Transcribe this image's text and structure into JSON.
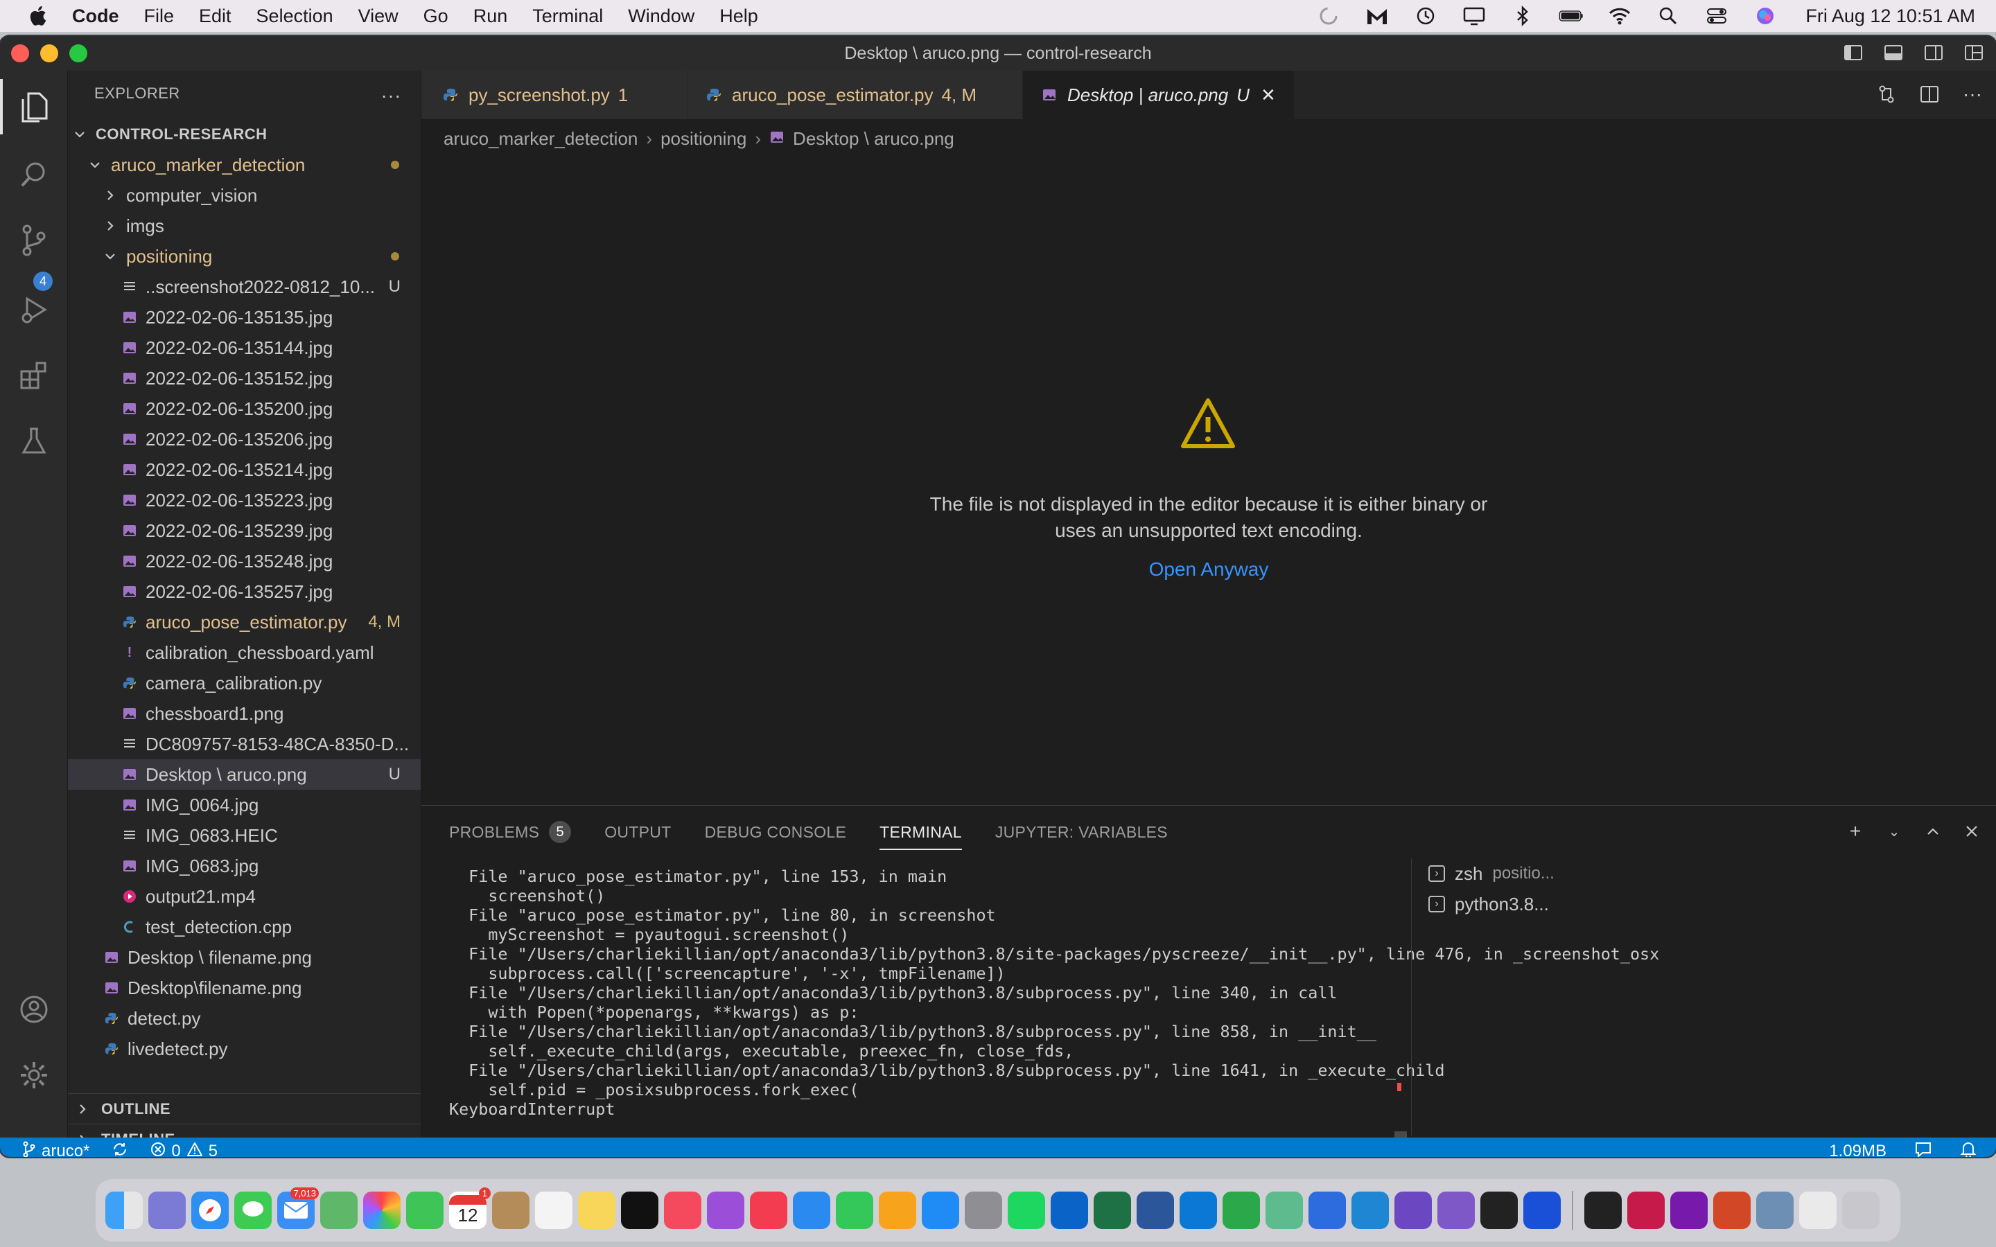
{
  "menubar": {
    "items": [
      "Code",
      "File",
      "Edit",
      "Selection",
      "View",
      "Go",
      "Run",
      "Terminal",
      "Window",
      "Help"
    ],
    "clock": "Fri Aug 12  10:51 AM"
  },
  "window": {
    "title": "Desktop \\ aruco.png — control-research"
  },
  "activity": {
    "scm_badge": "4"
  },
  "sidebar": {
    "header": "EXPLORER",
    "more": "···",
    "root": "CONTROL-RESEARCH",
    "tree": [
      {
        "label": "aruco_marker_detection",
        "indent": 0,
        "kind": "folder-open",
        "color": "yellow",
        "dot": true
      },
      {
        "label": "computer_vision",
        "indent": 1,
        "kind": "folder-closed"
      },
      {
        "label": "imgs",
        "indent": 1,
        "kind": "folder-closed"
      },
      {
        "label": "positioning",
        "indent": 1,
        "kind": "folder-open",
        "color": "yellow",
        "dot": true
      },
      {
        "label": "..screenshot2022-0812_10...",
        "indent": 2,
        "kind": "lines",
        "status": "U"
      },
      {
        "label": "2022-02-06-135135.jpg",
        "indent": 2,
        "kind": "image"
      },
      {
        "label": "2022-02-06-135144.jpg",
        "indent": 2,
        "kind": "image"
      },
      {
        "label": "2022-02-06-135152.jpg",
        "indent": 2,
        "kind": "image"
      },
      {
        "label": "2022-02-06-135200.jpg",
        "indent": 2,
        "kind": "image"
      },
      {
        "label": "2022-02-06-135206.jpg",
        "indent": 2,
        "kind": "image"
      },
      {
        "label": "2022-02-06-135214.jpg",
        "indent": 2,
        "kind": "image"
      },
      {
        "label": "2022-02-06-135223.jpg",
        "indent": 2,
        "kind": "image"
      },
      {
        "label": "2022-02-06-135239.jpg",
        "indent": 2,
        "kind": "image"
      },
      {
        "label": "2022-02-06-135248.jpg",
        "indent": 2,
        "kind": "image"
      },
      {
        "label": "2022-02-06-135257.jpg",
        "indent": 2,
        "kind": "image"
      },
      {
        "label": "aruco_pose_estimator.py",
        "indent": 2,
        "kind": "python",
        "color": "yellow",
        "status": "4, M"
      },
      {
        "label": "calibration_chessboard.yaml",
        "indent": 2,
        "kind": "yaml"
      },
      {
        "label": "camera_calibration.py",
        "indent": 2,
        "kind": "python"
      },
      {
        "label": "chessboard1.png",
        "indent": 2,
        "kind": "image"
      },
      {
        "label": "DC809757-8153-48CA-8350-D...",
        "indent": 2,
        "kind": "lines"
      },
      {
        "label": "Desktop \\ aruco.png",
        "indent": 2,
        "kind": "image",
        "status": "U",
        "selected": true
      },
      {
        "label": "IMG_0064.jpg",
        "indent": 2,
        "kind": "image"
      },
      {
        "label": "IMG_0683.HEIC",
        "indent": 2,
        "kind": "lines"
      },
      {
        "label": "IMG_0683.jpg",
        "indent": 2,
        "kind": "image"
      },
      {
        "label": "output21.mp4",
        "indent": 2,
        "kind": "video"
      },
      {
        "label": "test_detection.cpp",
        "indent": 2,
        "kind": "cpp"
      },
      {
        "label": "Desktop \\ filename.png",
        "indent": 1,
        "kind": "image"
      },
      {
        "label": "Desktop\\filename.png",
        "indent": 1,
        "kind": "image"
      },
      {
        "label": "detect.py",
        "indent": 1,
        "kind": "python"
      },
      {
        "label": "livedetect.py",
        "indent": 1,
        "kind": "python"
      }
    ],
    "outline": "OUTLINE",
    "timeline": "TIMELINE"
  },
  "tabs": [
    {
      "label": "py_screenshot.py",
      "status": "1",
      "kind": "python"
    },
    {
      "label": "aruco_pose_estimator.py",
      "status": "4, M",
      "kind": "python"
    },
    {
      "label": "Desktop | aruco.png",
      "status": "U",
      "kind": "image",
      "active": true
    }
  ],
  "breadcrumb": [
    "aruco_marker_detection",
    "positioning",
    "Desktop \\ aruco.png"
  ],
  "editor": {
    "message_line1": "The file is not displayed in the editor because it is either binary or",
    "message_line2": "uses an unsupported text encoding.",
    "open_anyway": "Open Anyway"
  },
  "panel": {
    "tabs": [
      {
        "label": "PROBLEMS",
        "badge": "5"
      },
      {
        "label": "OUTPUT"
      },
      {
        "label": "DEBUG CONSOLE"
      },
      {
        "label": "TERMINAL",
        "active": true
      },
      {
        "label": "JUPYTER: VARIABLES"
      }
    ],
    "terminal_lines": [
      "  File \"aruco_pose_estimator.py\", line 153, in main",
      "    screenshot()",
      "  File \"aruco_pose_estimator.py\", line 80, in screenshot",
      "    myScreenshot = pyautogui.screenshot()",
      "  File \"/Users/charliekillian/opt/anaconda3/lib/python3.8/site-packages/pyscreeze/__init__.py\", line 476, in _screenshot_osx",
      "    subprocess.call(['screencapture', '-x', tmpFilename])",
      "  File \"/Users/charliekillian/opt/anaconda3/lib/python3.8/subprocess.py\", line 340, in call",
      "    with Popen(*popenargs, **kwargs) as p:",
      "  File \"/Users/charliekillian/opt/anaconda3/lib/python3.8/subprocess.py\", line 858, in __init__",
      "    self._execute_child(args, executable, preexec_fn, close_fds,",
      "  File \"/Users/charliekillian/opt/anaconda3/lib/python3.8/subprocess.py\", line 1641, in _execute_child",
      "    self.pid = _posixsubprocess.fork_exec(",
      "KeyboardInterrupt"
    ],
    "terminals": [
      {
        "name": "zsh",
        "detail": "positio..."
      },
      {
        "name": "python3.8...",
        "detail": ""
      }
    ]
  },
  "statusbar": {
    "branch": "aruco*",
    "errors": "0",
    "warnings": "5",
    "filesize": "1.09MB"
  },
  "dock": {
    "calendar_badge": "1",
    "calendar_date": "12",
    "mail_badge": "7,013"
  }
}
